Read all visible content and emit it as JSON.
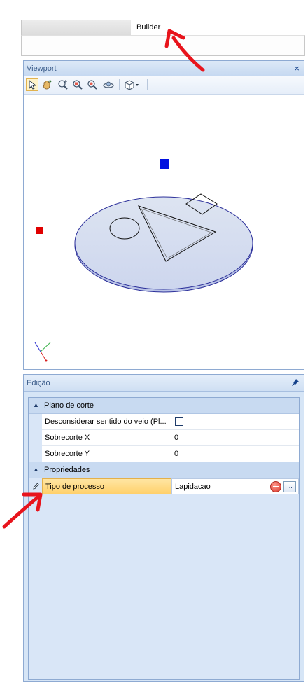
{
  "tabs": [
    {
      "label": ""
    },
    {
      "label": "Builder"
    }
  ],
  "viewport": {
    "title": "Viewport",
    "close": "×",
    "tools": [
      "select-icon",
      "pan-hand-icon",
      "zoom-extents-icon",
      "zoom-window-icon",
      "zoom-icon",
      "orbit-icon",
      "view-cube-icon"
    ]
  },
  "edicao": {
    "title": "Edição",
    "categories": [
      {
        "label": "Plano de corte",
        "properties": [
          {
            "name": "Desconsiderar sentido do veio (Pl...",
            "value": "",
            "checked": false
          },
          {
            "name": "Sobrecorte X",
            "value": "0"
          },
          {
            "name": "Sobrecorte Y",
            "value": "0"
          }
        ]
      },
      {
        "label": "Propriedades",
        "properties": [
          {
            "name": "Tipo de processo",
            "value": "Lapidacao"
          }
        ]
      }
    ],
    "more_button": "..."
  },
  "colors": {
    "accent": "#2b579a",
    "annotation": "#e8141c",
    "disc_fill": "#d5ddf0",
    "marker_x": "#e00000",
    "marker_z": "#0010e0"
  }
}
